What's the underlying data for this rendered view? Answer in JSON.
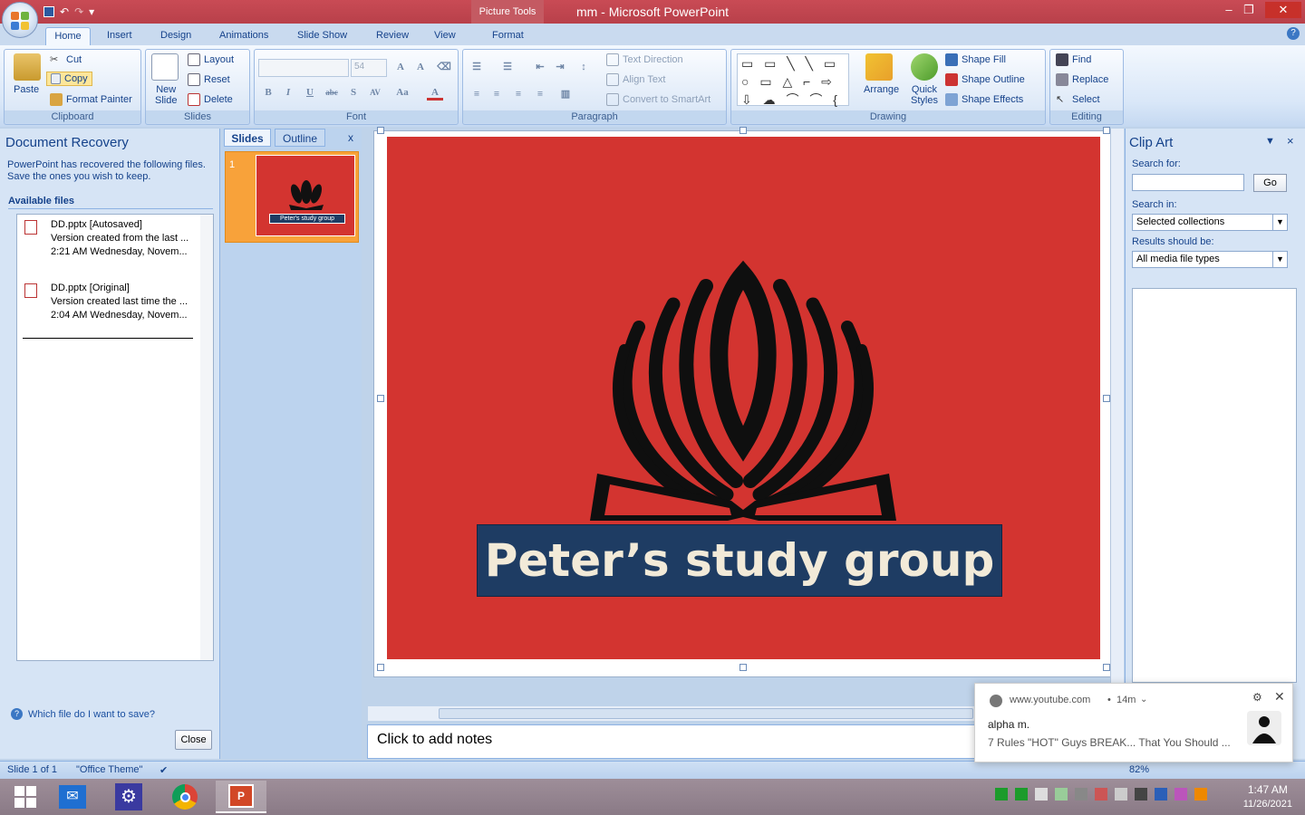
{
  "window": {
    "title": "mm - Microsoft PowerPoint",
    "context_tab": "Picture Tools",
    "minimize": "–",
    "restore": "❐",
    "close": "✕"
  },
  "tabs": [
    "Home",
    "Insert",
    "Design",
    "Animations",
    "Slide Show",
    "Review",
    "View",
    "Format"
  ],
  "active_tab": "Home",
  "ribbon": {
    "clipboard": {
      "paste": "Paste",
      "cut": "Cut",
      "copy": "Copy",
      "format_painter": "Format Painter",
      "label": "Clipboard"
    },
    "slides": {
      "new_slide": "New",
      "new_slide2": "Slide",
      "layout": "Layout",
      "reset": "Reset",
      "delete": "Delete",
      "label": "Slides"
    },
    "font": {
      "font_size": "54",
      "label": "Font"
    },
    "paragraph": {
      "text_direction": "Text Direction",
      "align_text": "Align Text",
      "convert_smartart": "Convert to SmartArt",
      "label": "Paragraph"
    },
    "drawing": {
      "arrange": "Arrange",
      "quick_styles": "Quick",
      "quick_styles2": "Styles",
      "shape_fill": "Shape Fill",
      "shape_outline": "Shape Outline",
      "shape_effects": "Shape Effects",
      "label": "Drawing"
    },
    "editing": {
      "find": "Find",
      "replace": "Replace",
      "select": "Select",
      "label": "Editing"
    }
  },
  "doc_recovery": {
    "title": "Document Recovery",
    "message": "PowerPoint has recovered the following files. Save the ones you wish to keep.",
    "available_label": "Available files",
    "files": [
      {
        "name": "DD.pptx  [Autosaved]",
        "line2": "Version created from the last ...",
        "line3": "2:21 AM Wednesday, Novem..."
      },
      {
        "name": "DD.pptx  [Original]",
        "line2": "Version created last time the ...",
        "line3": "2:04 AM Wednesday, Novem..."
      }
    ],
    "which_link": "Which file do I want to save?",
    "close_button": "Close"
  },
  "slides_panel": {
    "tab_slides": "Slides",
    "tab_outline": "Outline",
    "close": "x",
    "thumb_number": "1",
    "thumb_text": "Peter's study group"
  },
  "slide": {
    "banner_text": "Peter’s study group"
  },
  "notes_placeholder": "Click to add notes",
  "clip_art": {
    "title": "Clip Art",
    "search_for_label": "Search for:",
    "search_value": "",
    "go_button": "Go",
    "search_in_label": "Search in:",
    "search_in_value": "Selected collections",
    "results_label": "Results should be:",
    "results_value": "All media file types"
  },
  "status": {
    "slide_count": "Slide 1 of 1",
    "theme": "\"Office Theme\"",
    "zoom": "82%"
  },
  "notification": {
    "site": "www.youtube.com",
    "age": "14m",
    "sender": "alpha m.",
    "message": "7 Rules \"HOT\" Guys BREAK... That You Should ..."
  },
  "clock": {
    "time": "1:47 AM",
    "date": "11/26/2021"
  }
}
